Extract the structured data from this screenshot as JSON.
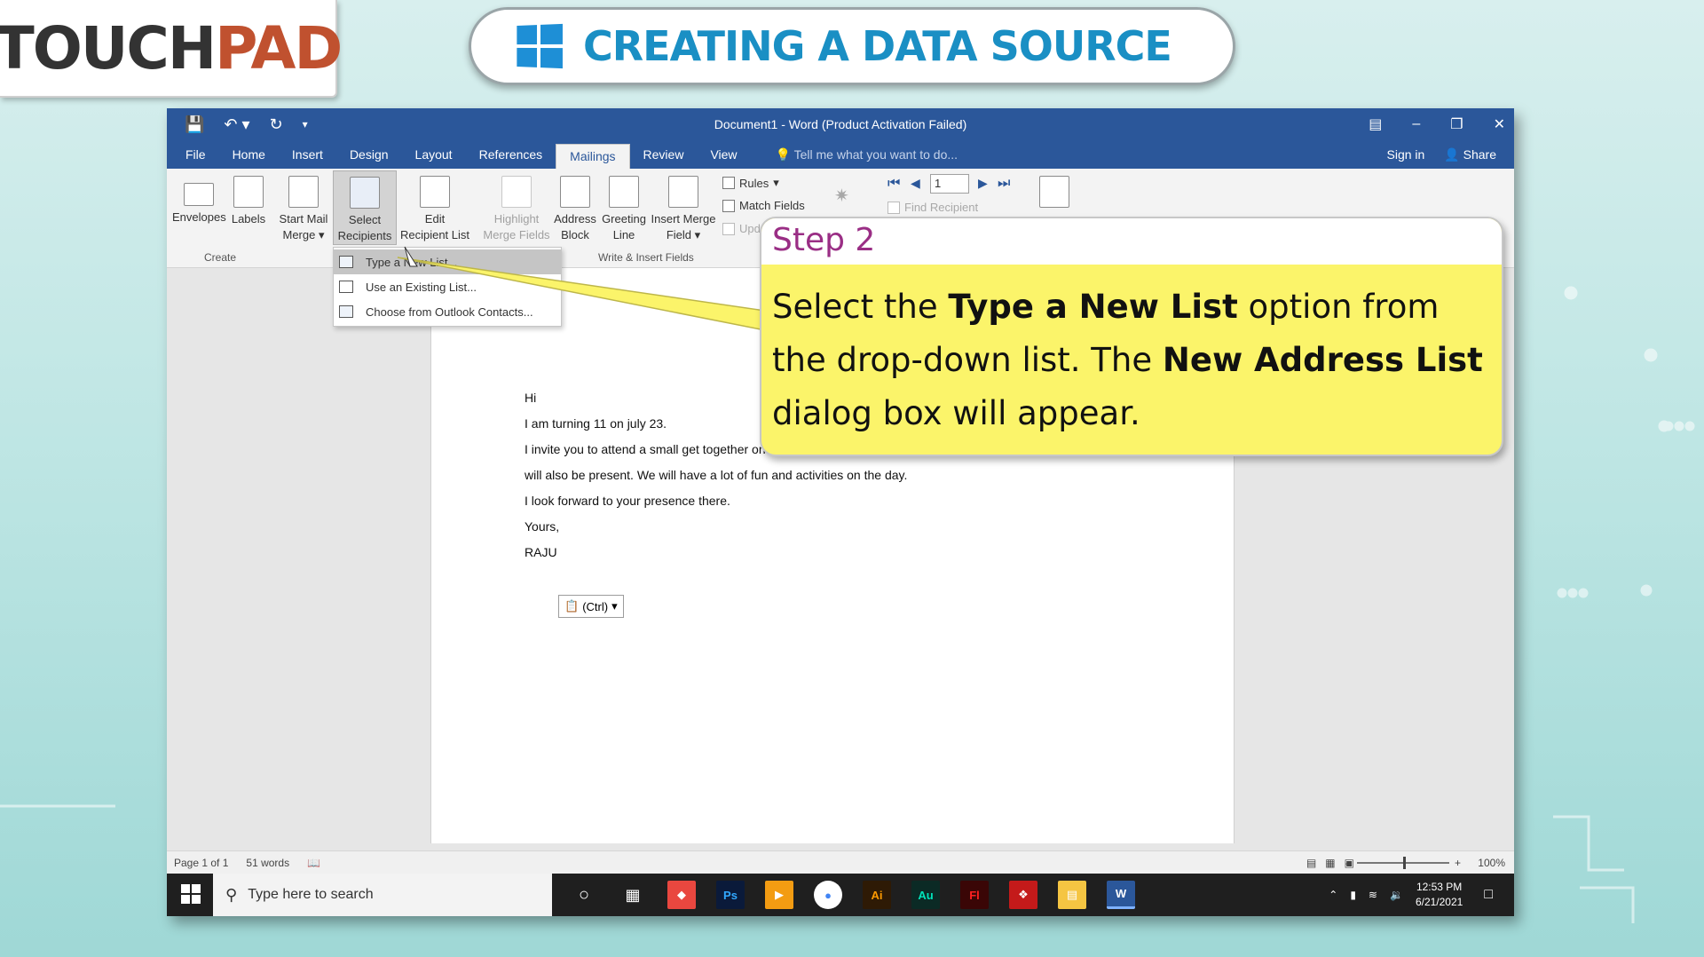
{
  "logo": {
    "text_a": "TOUCH",
    "text_b": "PAD"
  },
  "title": "CREATING A DATA SOURCE",
  "word": {
    "doc_title": "Document1 - Word (Product Activation Failed)",
    "tabs": [
      "File",
      "Home",
      "Insert",
      "Design",
      "Layout",
      "References",
      "Mailings",
      "Review",
      "View"
    ],
    "tell_me": "Tell me what you want to do...",
    "sign_in": "Sign in",
    "share": "Share",
    "ribbon": {
      "envelopes": "Envelopes",
      "labels": "Labels",
      "start_mail_1": "Start Mail",
      "start_mail_2": "Merge",
      "select_1": "Select",
      "select_2": "Recipients",
      "edit_1": "Edit",
      "edit_2": "Recipient List",
      "highlight_1": "Highlight",
      "highlight_2": "Merge Fields",
      "address_1": "Address",
      "address_2": "Block",
      "greeting_1": "Greeting",
      "greeting_2": "Line",
      "insert_merge_1": "Insert Merge",
      "insert_merge_2": "Field",
      "rules": "Rules",
      "match_fields": "Match Fields",
      "update": "Upd",
      "find_recipient": "Find Recipient",
      "record": "1",
      "group_create": "Create",
      "group_write": "Write & Insert Fields"
    },
    "dropdown": [
      "Type a New List...",
      "Use an Existing List...",
      "Choose from Outlook Contacts..."
    ],
    "document_lines": [
      "Hi",
      "I am  turning 11 on july 23.",
      "I invite you to attend a small get together on this occasion at my residence. Some other friends",
      "will also be present. We will have a lot of fun and activities on the day.",
      "I look forward to your presence there.",
      "Yours,",
      "RAJU"
    ],
    "paste_label": "(Ctrl)",
    "status": {
      "page": "Page 1 of 1",
      "words": "51 words",
      "zoom": "100%"
    },
    "taskbar": {
      "search_placeholder": "Type here to search",
      "time": "12:53 PM",
      "date": "6/21/2021"
    }
  },
  "callout": {
    "heading": "Step 2",
    "p1": "Select the ",
    "b1": "Type a New List",
    "p2": " option from the drop-down list. The ",
    "b2": "New Address List",
    "p3": " dialog box will appear."
  },
  "colors": {
    "word_blue": "#2b579a",
    "callout_yellow": "#fbf46a",
    "title_blue": "#1a8fc4",
    "step_purple": "#9a2e85"
  }
}
